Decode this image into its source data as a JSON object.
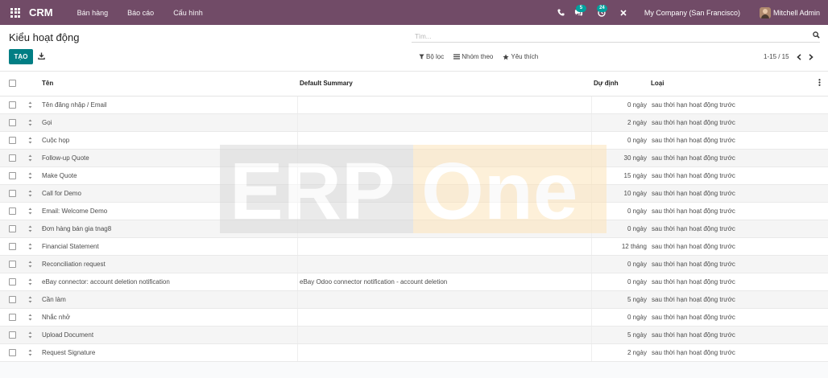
{
  "app": {
    "name": "CRM",
    "menu": [
      "Bán hàng",
      "Báo cáo",
      "Cấu hình"
    ]
  },
  "navbar": {
    "messages_count": "5",
    "activities_count": "24",
    "company": "My Company (San Francisco)",
    "user": "Mitchell Admin"
  },
  "page": {
    "title": "Kiểu hoạt động",
    "create_label": "TẠO",
    "search_placeholder": "Tìm...",
    "filters": {
      "filter_label": "Bộ lọc",
      "group_label": "Nhóm theo",
      "favorites_label": "Yêu thích"
    },
    "pager": "1-15 / 15"
  },
  "columns": {
    "name": "Tên",
    "summary": "Default Summary",
    "delay": "Dự định",
    "type": "Loại"
  },
  "rows": [
    {
      "name": "Tên đăng nhập / Email",
      "summary": "",
      "delay": "0 ngày",
      "type": "sau thời hạn hoạt động trước"
    },
    {
      "name": "Gọi",
      "summary": "",
      "delay": "2 ngày",
      "type": "sau thời hạn hoạt động trước"
    },
    {
      "name": "Cuộc họp",
      "summary": "",
      "delay": "0 ngày",
      "type": "sau thời hạn hoạt động trước"
    },
    {
      "name": "Follow-up Quote",
      "summary": "",
      "delay": "30 ngày",
      "type": "sau thời hạn hoạt động trước"
    },
    {
      "name": "Make Quote",
      "summary": "",
      "delay": "15 ngày",
      "type": "sau thời hạn hoạt động trước"
    },
    {
      "name": "Call for Demo",
      "summary": "",
      "delay": "10 ngày",
      "type": "sau thời hạn hoạt động trước"
    },
    {
      "name": "Email: Welcome Demo",
      "summary": "",
      "delay": "0 ngày",
      "type": "sau thời hạn hoạt động trước"
    },
    {
      "name": "Đơn hàng bán gia tnag8",
      "summary": "",
      "delay": "0 ngày",
      "type": "sau thời hạn hoạt động trước"
    },
    {
      "name": "Financial Statement",
      "summary": "",
      "delay": "12 tháng",
      "type": "sau thời hạn hoạt động trước"
    },
    {
      "name": "Reconciliation request",
      "summary": "",
      "delay": "0 ngày",
      "type": "sau thời hạn hoạt động trước"
    },
    {
      "name": "eBay connector: account deletion notification",
      "summary": "eBay Odoo connector notification - account deletion",
      "delay": "0 ngày",
      "type": "sau thời hạn hoạt động trước"
    },
    {
      "name": "Cần làm",
      "summary": "",
      "delay": "5 ngày",
      "type": "sau thời hạn hoạt động trước"
    },
    {
      "name": "Nhắc nhở",
      "summary": "",
      "delay": "0 ngày",
      "type": "sau thời hạn hoạt động trước"
    },
    {
      "name": "Upload Document",
      "summary": "",
      "delay": "5 ngày",
      "type": "sau thời hạn hoạt động trước"
    },
    {
      "name": "Request Signature",
      "summary": "",
      "delay": "2 ngày",
      "type": "sau thời hạn hoạt động trước"
    }
  ],
  "watermark": {
    "left": "ERP",
    "right": "One"
  },
  "colors": {
    "navbar": "#714b67",
    "primary_button": "#017e84",
    "badge": "#00a09d"
  },
  "icons": [
    "apps-grid-icon",
    "phone-icon",
    "chat-icon",
    "activity-clock-icon",
    "close-icon",
    "search-icon",
    "download-icon",
    "filter-icon",
    "group-by-icon",
    "star-icon",
    "chevron-left-icon",
    "chevron-right-icon",
    "drag-handle-icon",
    "column-options-icon"
  ]
}
